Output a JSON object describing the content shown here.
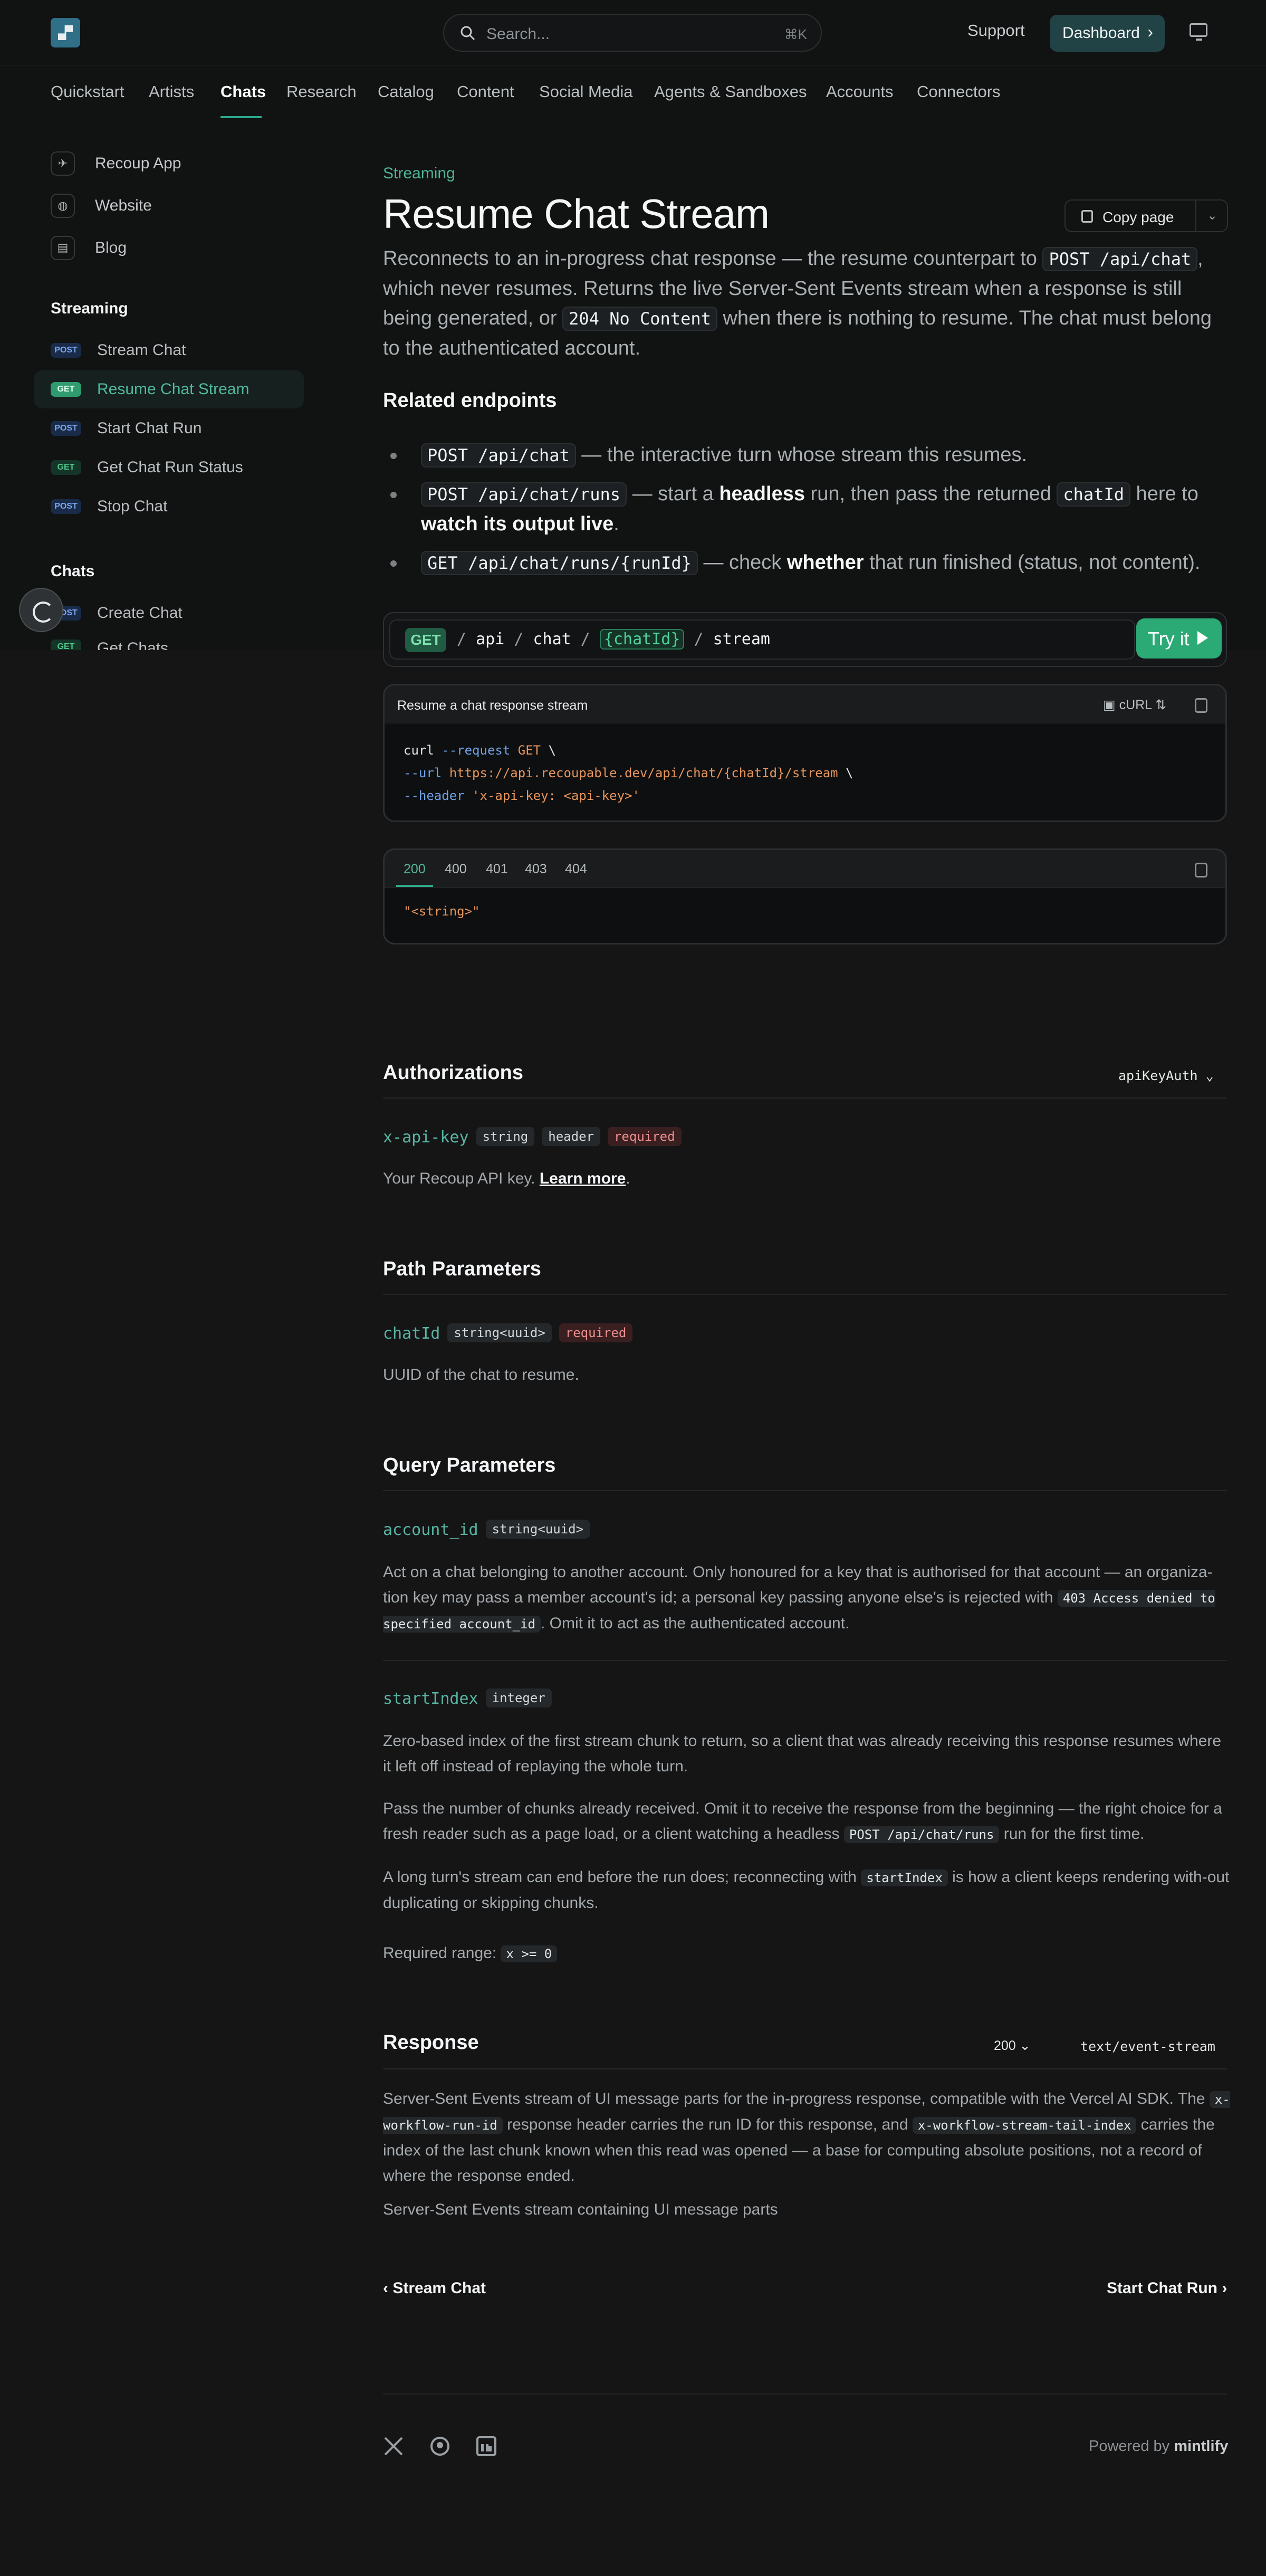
{
  "topbar": {
    "search_placeholder": "Search...",
    "search_shortcut": "⌘K",
    "support": "Support",
    "dashboard": "Dashboard"
  },
  "nav": {
    "tabs": [
      "Quickstart",
      "Artists",
      "Chats",
      "Research",
      "Catalog",
      "Content",
      "Social Media",
      "Agents & Sandboxes",
      "Accounts",
      "Connectors"
    ],
    "active": "Chats"
  },
  "sidebar": {
    "links": [
      "Recoup App",
      "Website",
      "Blog"
    ],
    "groups": [
      {
        "title": "Streaming",
        "items": [
          {
            "method": "POST",
            "label": "Stream Chat"
          },
          {
            "method": "GET",
            "label": "Resume Chat Stream",
            "active": true
          },
          {
            "method": "POST",
            "label": "Start Chat Run"
          },
          {
            "method": "GET",
            "label": "Get Chat Run Status"
          },
          {
            "method": "POST",
            "label": "Stop Chat"
          }
        ]
      },
      {
        "title": "Chats",
        "items": [
          {
            "method": "POST",
            "label": "Create Chat"
          },
          {
            "method": "GET",
            "label": "Get Chats"
          }
        ]
      }
    ]
  },
  "page": {
    "eyebrow": "Streaming",
    "title": "Resume Chat Stream",
    "copy_page": "Copy page",
    "lead": {
      "t1": "Reconnects to an in-progress chat response — the resume counterpart to ",
      "c1": "POST /api/chat",
      "t2": ", which never resumes. Returns the live Server-Sent Events stream when a response is still being generated, or ",
      "c2": "204 No Content",
      "t3": " when there is nothing to resume. The chat must belong to the authenticated account."
    },
    "related_title": "Related endpoints",
    "related": [
      {
        "code": "POST /api/chat",
        "a": " — the interactive turn whose stream this resumes."
      },
      {
        "code": "POST /api/chat/runs",
        "a": " — start a ",
        "b1": "headless",
        "c": " run, then pass the returned ",
        "code2": "chatId",
        "d": " here to ",
        "b2": "watch its output live",
        "e": "."
      },
      {
        "code": "GET /api/chat/runs/{runId}",
        "a": " — check ",
        "b1": "whether",
        "c": " that run finished (status, not content)."
      }
    ]
  },
  "endpoint": {
    "method": "GET",
    "path": [
      "api",
      "chat",
      "{chatId}",
      "stream"
    ],
    "try_it": "Try it"
  },
  "request": {
    "title": "Resume a chat response stream",
    "lang": "cURL",
    "lines": [
      {
        "a": "curl",
        "b": " --request",
        "c": " GET",
        "d": " \\"
      },
      {
        "a": "  --url",
        "b": " https://api.recoupable.dev/api/chat/{chatId}/stream",
        "c": " \\"
      },
      {
        "a": "  --header",
        "b": " 'x-api-key: <api-key>'"
      }
    ]
  },
  "response_example": {
    "tabs": [
      "200",
      "400",
      "401",
      "403",
      "404"
    ],
    "active": "200",
    "body": "\"<string>\""
  },
  "auth": {
    "title": "Authorizations",
    "scheme": "apiKeyAuth",
    "field": "x-api-key",
    "type": "string",
    "location": "header",
    "required": "required",
    "desc": "Your Recoup API key. ",
    "learn_more": "Learn more",
    "period": "."
  },
  "path_params": {
    "title": "Path Parameters",
    "field": "chatId",
    "type": "string<uuid>",
    "required": "required",
    "desc": "UUID of the chat to resume."
  },
  "query_params": {
    "title": "Query Parameters",
    "account_id": {
      "field": "account_id",
      "type": "string<uuid>",
      "d1": "Act on a chat belonging to another account. Only honoured for a key that is authorised for that account — an organiza-tion key may pass a member account's id; a personal key passing anyone else's is rejected with ",
      "c1": "403 Access denied to specified account_id",
      "d2": ". Omit it to act as the authenticated account."
    },
    "start_index": {
      "field": "startIndex",
      "type": "integer",
      "p1": "Zero-based index of the first stream chunk to return, so a client that was already receiving this response resumes where it left off instead of replaying the whole turn.",
      "p2a": "Pass the number of chunks already received. Omit it to receive the response from the beginning — the right choice for a fresh reader such as a page load, or a client watching a headless ",
      "p2c": "POST /api/chat/runs",
      "p2b": " run for the first time.",
      "p3a": "A long turn's stream can end before the run does; reconnecting with ",
      "p3c": "startIndex",
      "p3b": " is how a client keeps rendering with-out duplicating or skipping chunks.",
      "range_label": "Required range: ",
      "range": "x >= 0"
    }
  },
  "response": {
    "title": "Response",
    "status": "200",
    "content_type": "text/event-stream",
    "d1": "Server-Sent Events stream of UI message parts for the in-progress response, compatible with the Vercel AI SDK. The ",
    "c1": "x-workflow-run-id",
    "d2": " response header carries the run ID for this response, and ",
    "c2": "x-workflow-stream-tail-index",
    "d3": " carries the index of the last chunk known when this read was opened — a base for computing absolute positions, not a record of where the response ended.",
    "d4": "Server-Sent Events stream containing UI message parts"
  },
  "pager": {
    "prev": "Stream Chat",
    "next": "Start Chat Run"
  },
  "footer": {
    "powered": "Powered by ",
    "brand": "mintlify"
  }
}
